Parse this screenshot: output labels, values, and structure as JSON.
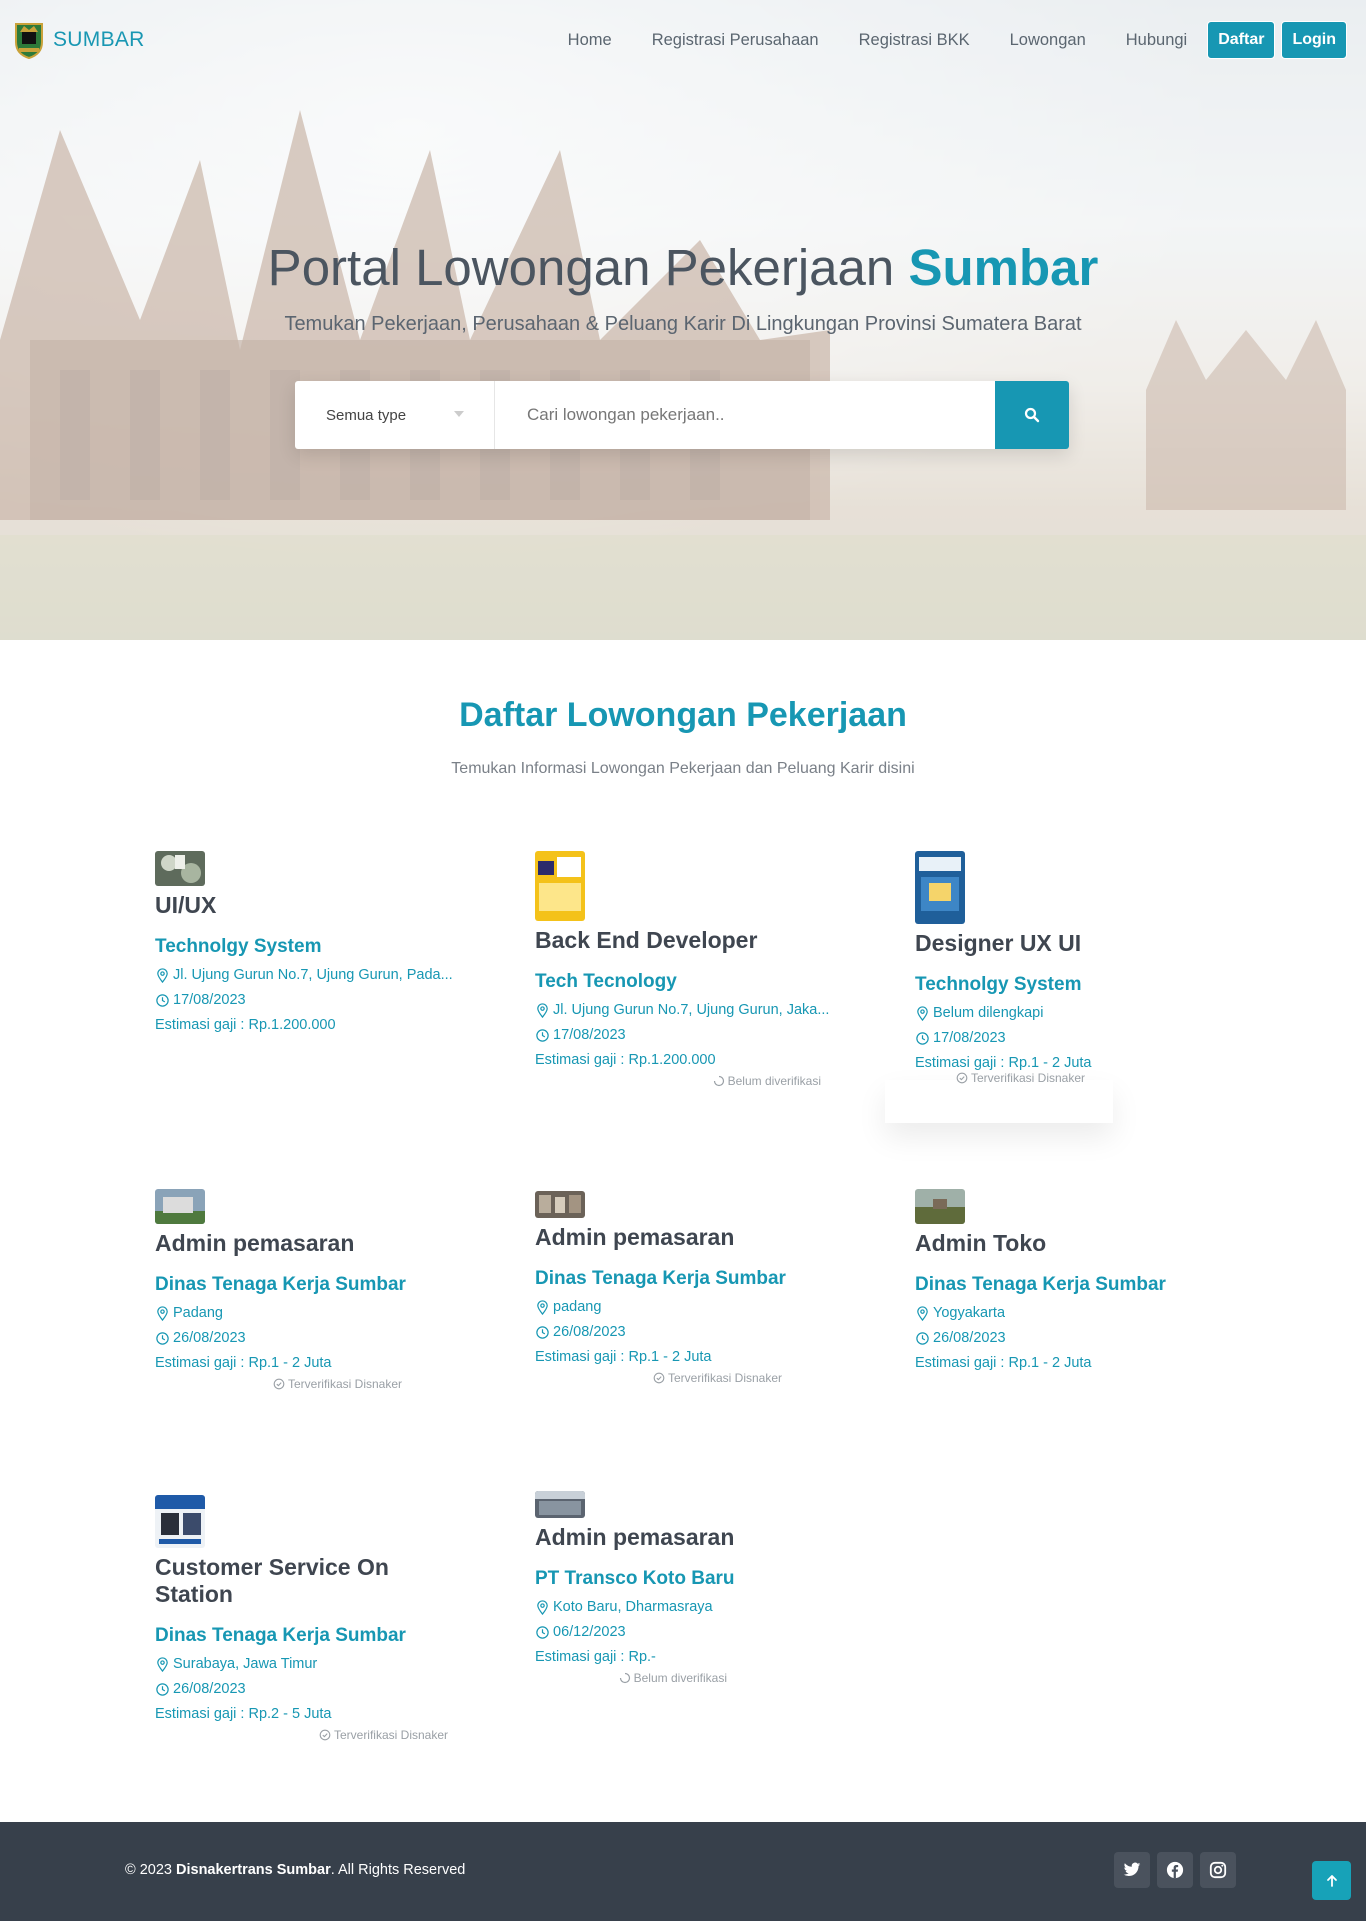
{
  "brand": {
    "name": "SUMBAR"
  },
  "nav": {
    "links": [
      "Home",
      "Registrasi Perusahaan",
      "Registrasi BKK",
      "Lowongan",
      "Hubungi"
    ],
    "daftar": "Daftar",
    "login": "Login"
  },
  "hero": {
    "title_main": "Portal Lowongan Pekerjaan",
    "title_accent": "Sumbar",
    "subtitle": "Temukan Pekerjaan, Perusahaan & Peluang Karir Di Lingkungan Provinsi Sumatera Barat"
  },
  "search": {
    "type_selected": "Semua type",
    "placeholder": "Cari lowongan pekerjaan.."
  },
  "section": {
    "title": "Daftar Lowongan Pekerjaan",
    "subtitle": "Temukan Informasi Lowongan Pekerjaan dan Peluang Karir disini"
  },
  "jobs": [
    {
      "title": "UI/UX",
      "company": "Technolgy System",
      "location": "Jl. Ujung Gurun No.7, Ujung Gurun, Pada...",
      "date": "17/08/2023",
      "salary": "Estimasi gaji : Rp.1.200.000",
      "status": ""
    },
    {
      "title": "Back End Developer",
      "company": "Tech Tecnology",
      "location": "Jl. Ujung Gurun No.7, Ujung Gurun, Jaka...",
      "date": "17/08/2023",
      "salary": "Estimasi gaji : Rp.1.200.000",
      "status": "Belum diverifikasi"
    },
    {
      "title": "Designer UX UI",
      "company": "Technolgy System",
      "location": "Belum dilengkapi",
      "date": "17/08/2023",
      "salary": "Estimasi gaji : Rp.1 - 2 Juta",
      "status": "Terverifikasi Disnaker"
    },
    {
      "title": "Admin pemasaran",
      "company": "Dinas Tenaga Kerja Sumbar",
      "location": "Padang",
      "date": "26/08/2023",
      "salary": "Estimasi gaji : Rp.1 - 2 Juta",
      "status": "Terverifikasi Disnaker"
    },
    {
      "title": "Admin pemasaran",
      "company": "Dinas Tenaga Kerja Sumbar",
      "location": "padang",
      "date": "26/08/2023",
      "salary": "Estimasi gaji : Rp.1 - 2 Juta",
      "status": "Terverifikasi Disnaker"
    },
    {
      "title": "Admin Toko",
      "company": "Dinas Tenaga Kerja Sumbar",
      "location": "Yogyakarta",
      "date": "26/08/2023",
      "salary": "Estimasi gaji : Rp.1 - 2 Juta",
      "status": ""
    },
    {
      "title": "Customer Service On Station",
      "company": "Dinas Tenaga Kerja Sumbar",
      "location": "Surabaya, Jawa Timur",
      "date": "26/08/2023",
      "salary": "Estimasi gaji : Rp.2 - 5 Juta",
      "status": "Terverifikasi Disnaker"
    },
    {
      "title": "Admin pemasaran",
      "company": "PT Transco Koto Baru",
      "location": "Koto Baru, Dharmasraya",
      "date": "06/12/2023",
      "salary": "Estimasi gaji : Rp.-",
      "status": "Belum diverifikasi"
    }
  ],
  "footer": {
    "copy_prefix": "© 2023 ",
    "copy_bold": "Disnakertrans Sumbar",
    "copy_suffix": ". All Rights Reserved",
    "social": [
      "twitter-icon",
      "facebook-icon",
      "instagram-icon"
    ]
  },
  "colors": {
    "accent": "#1797b3",
    "footer": "#37404b",
    "to_top": "#17a2b8"
  }
}
